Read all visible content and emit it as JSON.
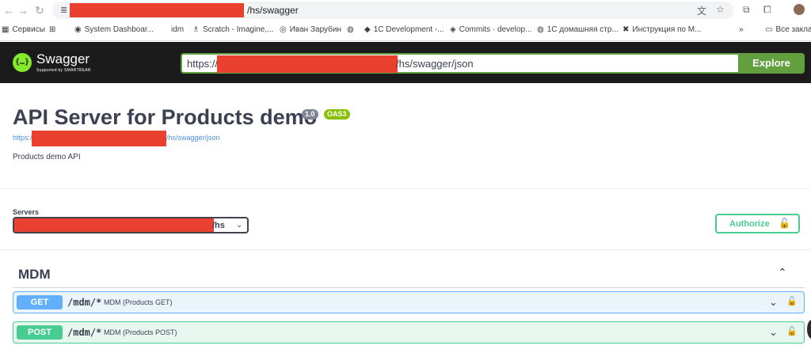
{
  "browser": {
    "nav_back": "←",
    "nav_forward": "→",
    "nav_reload": "↻",
    "site_icon": "≣",
    "url_suffix": "/hs/swagger",
    "translate_icon": "文",
    "star_icon": "☆",
    "ext_icon": "⧉",
    "puzzle_icon": "⧠"
  },
  "bookmarks": [
    {
      "icon": "▦",
      "label": "Сервисы"
    },
    {
      "icon": "⊞",
      "label": ""
    },
    {
      "icon": "◉",
      "label": "System Dashboar..."
    },
    {
      "icon": "",
      "label": "idm"
    },
    {
      "icon": "♗",
      "label": "Scratch - Imagine,..."
    },
    {
      "icon": "◎",
      "label": "Иван Зарубин"
    },
    {
      "icon": "◍",
      "label": ""
    },
    {
      "icon": "◆",
      "label": "1C Development -..."
    },
    {
      "icon": "◈",
      "label": "Commits · develop..."
    },
    {
      "icon": "◍",
      "label": "1С домашняя стр..."
    },
    {
      "icon": "✖",
      "label": "Инструкция по M..."
    },
    {
      "icon": "»",
      "label": ""
    },
    {
      "icon": "▭",
      "label": "Все закла"
    }
  ],
  "topbar": {
    "logo_glyph": "{…}",
    "logo_name": "Swagger",
    "logo_sub": "Supported by SMARTBEAR",
    "spec_prefix": "https://",
    "spec_suffix": "/hs/swagger/json",
    "explore_label": "Explore"
  },
  "info": {
    "title": "API Server for Products demo",
    "version": "1.0",
    "oas": "OAS3",
    "link_prefix": "https:/",
    "link_suffix": "/hs/swagger/json",
    "description": "Products demo API"
  },
  "servers": {
    "label": "Servers",
    "selected_suffix": "/hs",
    "chevron": "⌄"
  },
  "authorize": {
    "label": "Authorize",
    "lock_icon": "🔓"
  },
  "tag": {
    "name": "MDM",
    "chevron": "⌃"
  },
  "operations": [
    {
      "method": "GET",
      "path": "/mdm/*",
      "summary": "MDM (Products GET)",
      "chevron": "⌄",
      "lock": "🔓"
    },
    {
      "method": "POST",
      "path": "/mdm/*",
      "summary": "MDM (Products POST)",
      "chevron": "⌄",
      "lock": "🔓"
    }
  ]
}
